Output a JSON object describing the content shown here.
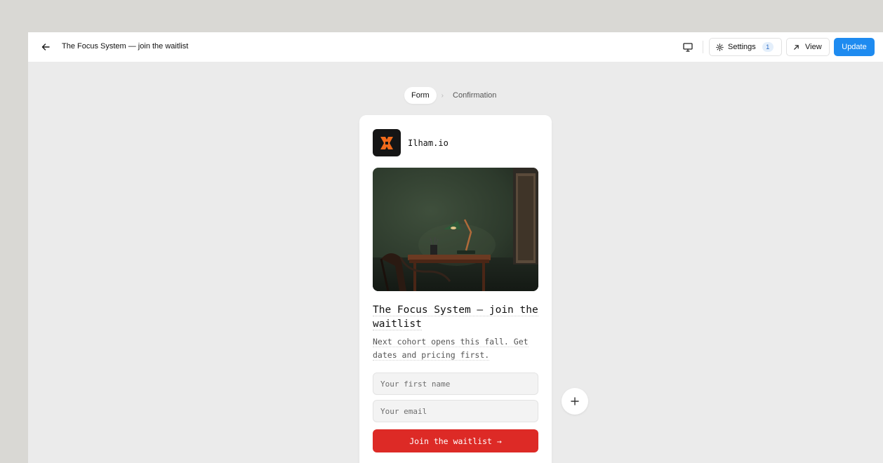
{
  "header": {
    "title": "The Focus System — join the waitlist",
    "settings_label": "Settings",
    "settings_badge": "1",
    "view_label": "View",
    "update_label": "Update"
  },
  "steps": [
    {
      "label": "Form",
      "active": true
    },
    {
      "label": "Confirmation",
      "active": false
    }
  ],
  "card": {
    "brand_name": "Ilham.io",
    "headline": "The Focus System — join the waitlist",
    "subtitle": "Next cohort opens this fall. Get dates and pricing first.",
    "first_name_placeholder": "Your first name",
    "email_placeholder": "Your email",
    "submit_label": "Join the waitlist →"
  },
  "colors": {
    "accent": "#1e8bf0",
    "submit": "#dd2a26",
    "logo_mark": "#f26a1b"
  },
  "icons": {
    "back": "arrow-left-icon",
    "device": "desktop-monitor-icon",
    "settings": "gear-icon",
    "view": "arrow-up-right-icon",
    "add": "plus-icon"
  }
}
